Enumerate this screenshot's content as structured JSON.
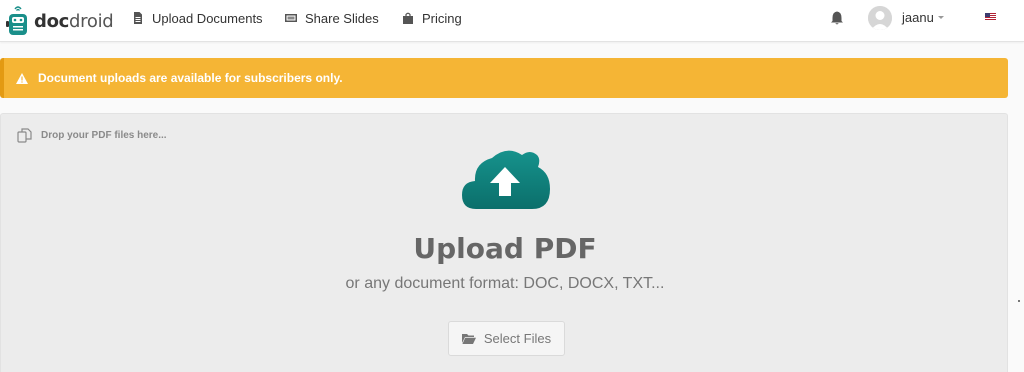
{
  "brand": {
    "part1": "doc",
    "part2": "droid",
    "logo_icon": "robot-logo-icon"
  },
  "nav": {
    "upload_documents": "Upload Documents",
    "share_slides": "Share Slides",
    "pricing": "Pricing"
  },
  "user": {
    "name": "jaanu"
  },
  "alert": {
    "text_before": "Document uploads are available for ",
    "emphasis": "subscribers",
    "text_after": " only."
  },
  "dropzone": {
    "hint": "Drop your PDF files here...",
    "title": "Upload PDF",
    "subtitle": "or any document format: DOC, DOCX, TXT...",
    "button_label": "Select Files"
  },
  "colors": {
    "accent_teal": "#0f7f7b",
    "alert_yellow": "#f5b535",
    "alert_border": "#e39a12"
  }
}
